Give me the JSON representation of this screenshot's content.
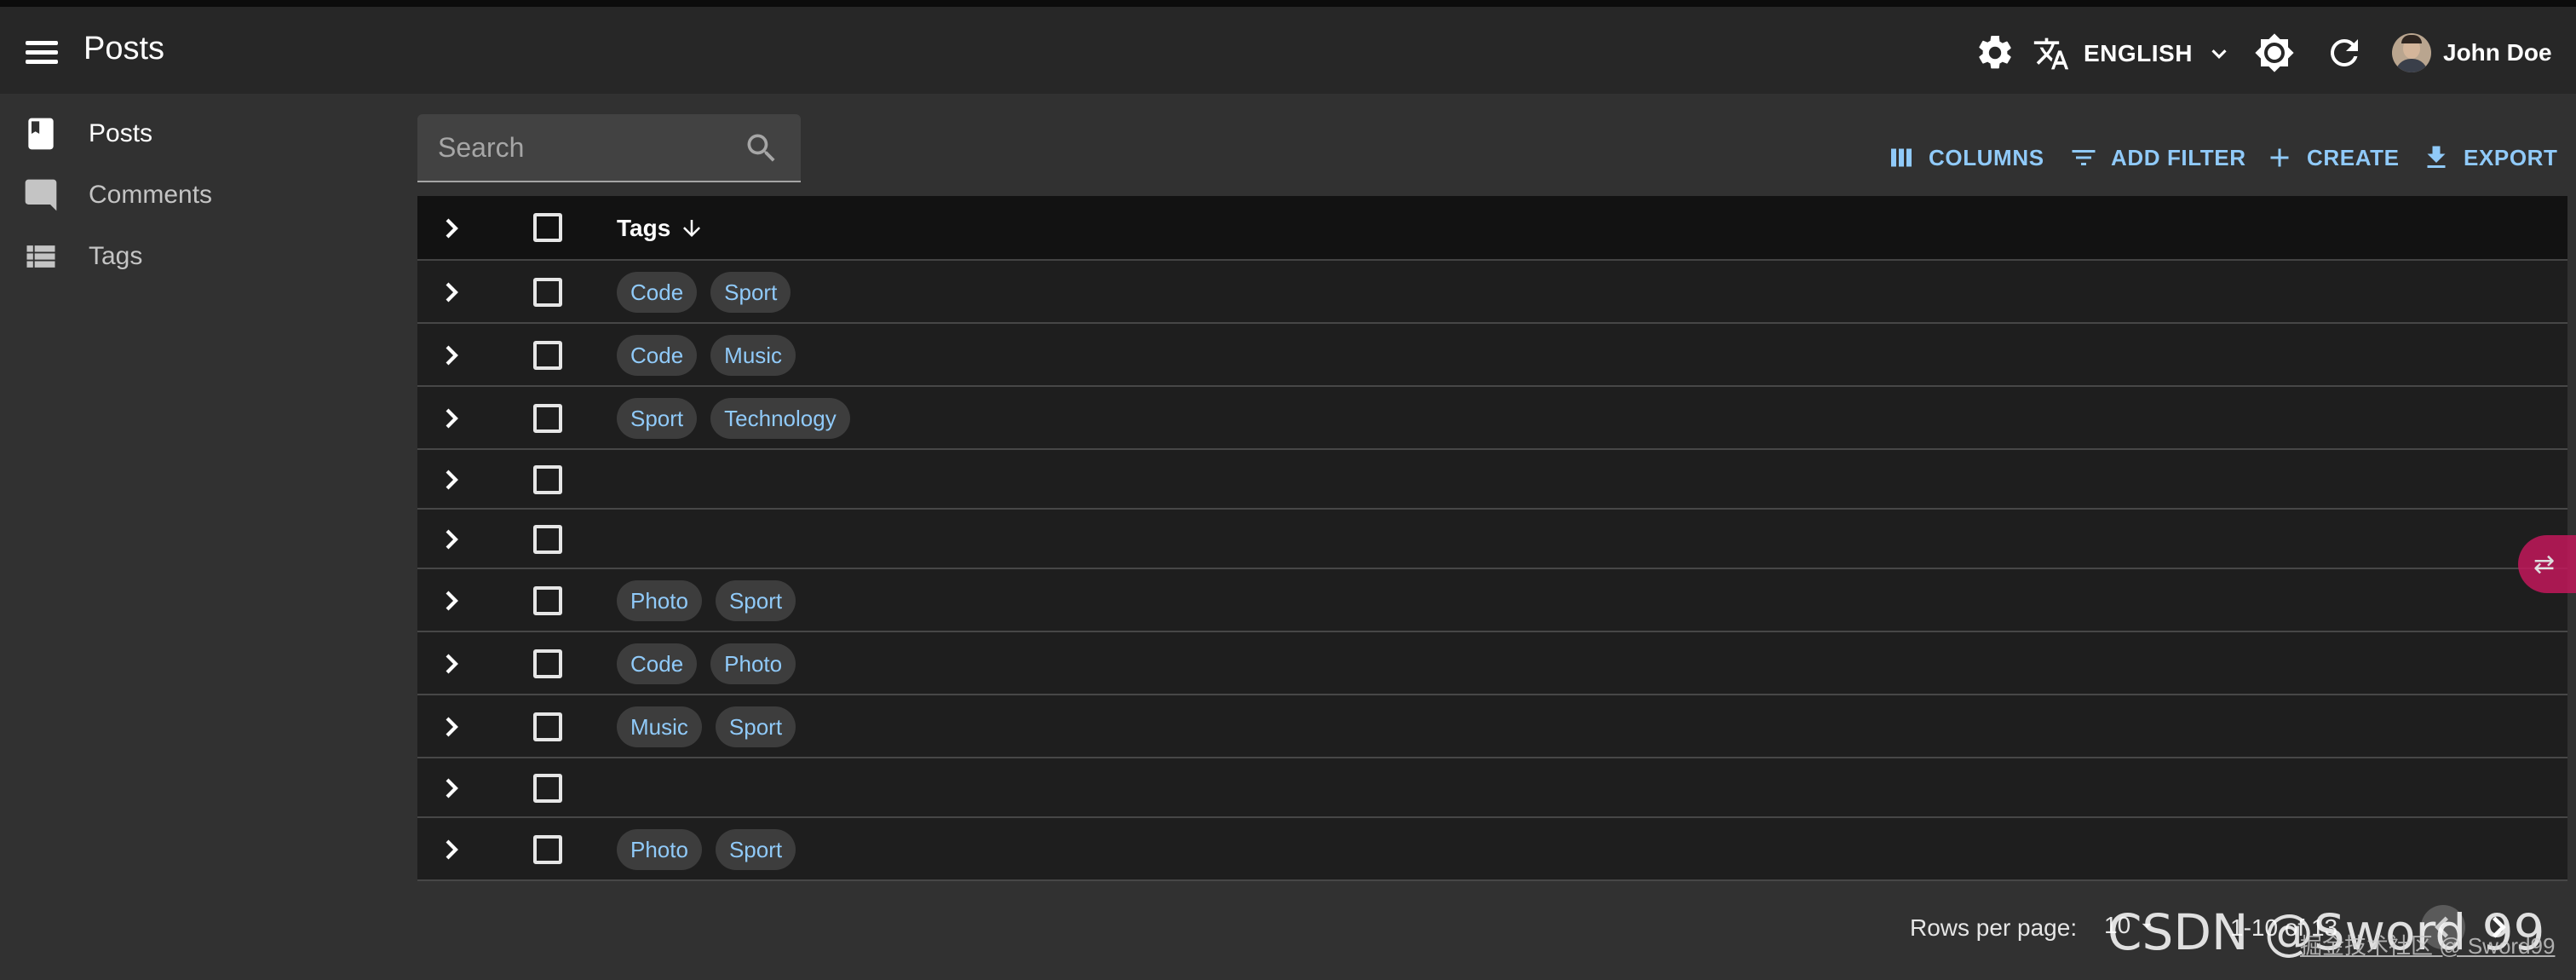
{
  "app": {
    "title": "Posts"
  },
  "topbar": {
    "language": "ENGLISH",
    "user_name": "John Doe"
  },
  "sidebar": {
    "items": [
      {
        "label": "Posts",
        "icon": "book-icon"
      },
      {
        "label": "Comments",
        "icon": "comment-icon"
      },
      {
        "label": "Tags",
        "icon": "list-icon"
      }
    ]
  },
  "search": {
    "placeholder": "Search"
  },
  "toolbar": {
    "columns_label": "COLUMNS",
    "add_filter_label": "ADD FILTER",
    "create_label": "CREATE",
    "export_label": "EXPORT"
  },
  "table": {
    "header": {
      "tags": "Tags",
      "sort": "descending"
    },
    "rows": [
      {
        "tags": [
          "Code",
          "Sport"
        ]
      },
      {
        "tags": [
          "Code",
          "Music"
        ]
      },
      {
        "tags": [
          "Sport",
          "Technology"
        ]
      },
      {
        "tags": []
      },
      {
        "tags": []
      },
      {
        "tags": [
          "Photo",
          "Sport"
        ]
      },
      {
        "tags": [
          "Code",
          "Photo"
        ]
      },
      {
        "tags": [
          "Music",
          "Sport"
        ]
      },
      {
        "tags": []
      },
      {
        "tags": [
          "Photo",
          "Sport"
        ]
      }
    ]
  },
  "pagination": {
    "rows_per_page_label": "Rows per page:",
    "rows_per_page_value": "10",
    "range": "1-10 of 13"
  },
  "watermark": {
    "text": "CSDN @Sword 99",
    "small_text": "掘金技术社区 @ Sword99"
  },
  "colors": {
    "accent": "#90caf9",
    "appbar": "#272727",
    "background": "#313131"
  }
}
